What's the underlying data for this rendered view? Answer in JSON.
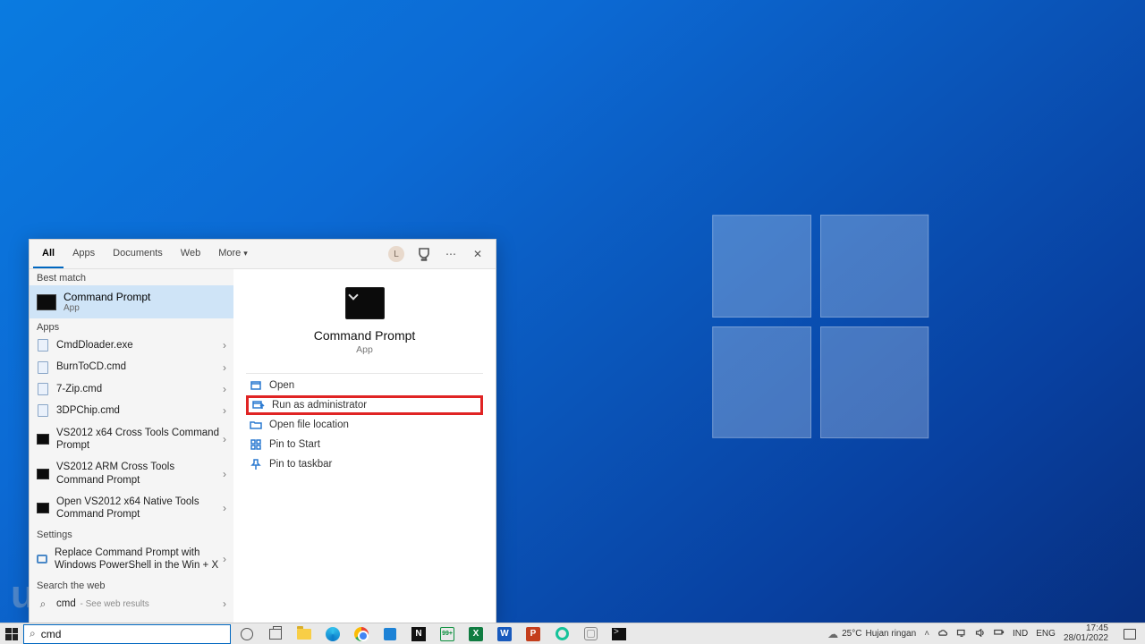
{
  "search_panel": {
    "tabs": {
      "all": "All",
      "apps": "Apps",
      "documents": "Documents",
      "web": "Web",
      "more": "More"
    },
    "avatar_initial": "L",
    "groups": {
      "best_match": "Best match",
      "apps": "Apps",
      "settings": "Settings",
      "search_web": "Search the web"
    },
    "best_match": {
      "title": "Command Prompt",
      "sub": "App"
    },
    "apps_list": [
      {
        "label": "CmdDloader.exe",
        "icon": "file"
      },
      {
        "label": "BurnToCD.cmd",
        "icon": "file"
      },
      {
        "label": "7-Zip.cmd",
        "icon": "file"
      },
      {
        "label": "3DPChip.cmd",
        "icon": "file"
      },
      {
        "label": "VS2012 x64 Cross Tools Command Prompt",
        "icon": "cmd"
      },
      {
        "label": "VS2012 ARM Cross Tools Command Prompt",
        "icon": "cmd"
      },
      {
        "label": "Open VS2012 x64 Native Tools Command Prompt",
        "icon": "cmd"
      }
    ],
    "settings_list": [
      {
        "label": "Replace Command Prompt with Windows PowerShell in the Win + X"
      }
    ],
    "web_list": {
      "term": "cmd",
      "hint": " - See web results"
    },
    "detail": {
      "title": "Command Prompt",
      "sub": "App",
      "actions": [
        {
          "label": "Open",
          "icon": "open",
          "hl": false
        },
        {
          "label": "Run as administrator",
          "icon": "admin",
          "hl": true
        },
        {
          "label": "Open file location",
          "icon": "folder",
          "hl": false
        },
        {
          "label": "Pin to Start",
          "icon": "pinstart",
          "hl": false
        },
        {
          "label": "Pin to taskbar",
          "icon": "pintask",
          "hl": false
        }
      ]
    }
  },
  "taskbar": {
    "search_value": "cmd",
    "apps": [
      "cortana",
      "taskview",
      "explorer",
      "edge",
      "chrome",
      "store",
      "notion",
      "badge",
      "excel",
      "word",
      "ppt",
      "grammarly",
      "generic",
      "term"
    ],
    "weather_temp": "25°C",
    "weather_text": "Hujan ringan",
    "ime1": "IND",
    "ime2": "ENG",
    "time": "17:45",
    "date": "28/01/2022",
    "watermark": "uplotify"
  }
}
